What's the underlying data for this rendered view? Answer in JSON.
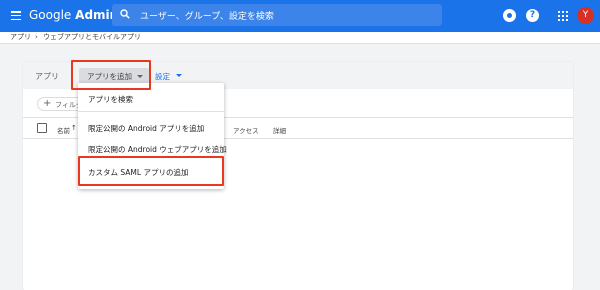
{
  "topbar": {
    "brand_google": "Google",
    "brand_admin": "Admin",
    "search_placeholder": "ユーザー、グループ、設定を検索",
    "avatar_letter": "Y",
    "help_glyph": "?"
  },
  "breadcrumb": {
    "root": "アプリ",
    "separator": "›",
    "current": "ウェブアプリとモバイルアプリ"
  },
  "card": {
    "apps_label": "アプリ",
    "add_app_label": "アプリを追加",
    "settings_label": "設定",
    "filter_label": "フィルタ",
    "filter_plus": "+",
    "columns": {
      "name": "名前",
      "access": "アクセス",
      "details": "詳細"
    }
  },
  "dropdown": {
    "items": [
      "アプリを検索",
      "限定公開の Android アプリを追加",
      "限定公開の Android ウェブアプリを追加",
      "カスタム SAML アプリの追加"
    ]
  },
  "colors": {
    "topbar": "#1a73e8",
    "highlight": "#e8391f",
    "link": "#1a73e8",
    "avatar": "#d93025"
  }
}
